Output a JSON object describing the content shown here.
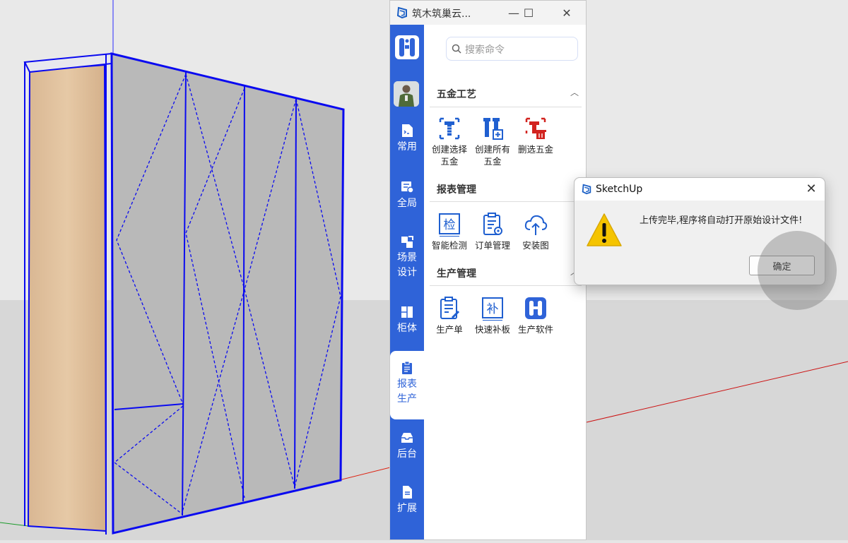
{
  "window": {
    "title": "筑木筑巢云...",
    "minimize_symbol": "—",
    "maximize_symbol": "☐",
    "close_symbol": "✕"
  },
  "search": {
    "placeholder": "搜索命令",
    "value": ""
  },
  "sidebar": {
    "items": [
      {
        "label": "常用",
        "icon": "file-code-icon"
      },
      {
        "label": "全局",
        "icon": "global-settings-icon"
      },
      {
        "label": "场景设计",
        "icon": "scene-design-icon"
      },
      {
        "label": "柜体",
        "icon": "cabinet-icon"
      },
      {
        "label": "报表生产",
        "icon": "clipboard-icon",
        "active": true
      },
      {
        "label": "后台",
        "icon": "tray-icon"
      },
      {
        "label": "扩展",
        "icon": "document-icon"
      }
    ]
  },
  "sections": [
    {
      "title": "五金工艺",
      "tools": [
        {
          "label": "创建选择五金",
          "icon": "screw-select-icon"
        },
        {
          "label": "创建所有五金",
          "icon": "screw-add-icon"
        },
        {
          "label": "删选五金",
          "icon": "screw-delete-icon"
        }
      ]
    },
    {
      "title": "报表管理",
      "tools": [
        {
          "label": "智能检测",
          "icon": "inspect-icon",
          "glyph": "检"
        },
        {
          "label": "订单管理",
          "icon": "order-icon"
        },
        {
          "label": "安装图",
          "icon": "cloud-upload-icon"
        }
      ]
    },
    {
      "title": "生产管理",
      "tools": [
        {
          "label": "生产单",
          "icon": "production-sheet-icon"
        },
        {
          "label": "快速补板",
          "icon": "patch-board-icon",
          "glyph": "补"
        },
        {
          "label": "生产软件",
          "icon": "production-software-icon"
        }
      ]
    }
  ],
  "dialog": {
    "title": "SketchUp",
    "message": "上传完毕,程序将自动打开原始设计文件!",
    "ok_label": "确定",
    "close_symbol": "✕"
  },
  "colors": {
    "accent": "#2f63d8",
    "hardware_icon_blue": "#1f5fd0",
    "delete_icon_red": "#d2231f",
    "warning_yellow": "#f5c400",
    "wireframe_blue": "#0a0af0"
  }
}
